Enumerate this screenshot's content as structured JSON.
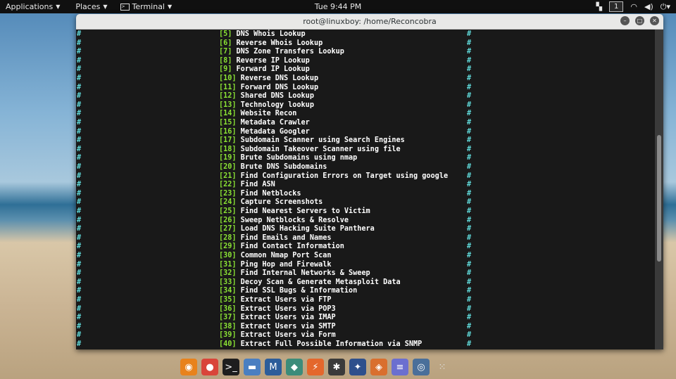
{
  "topbar": {
    "applications": "Applications",
    "places": "Places",
    "terminal": "Terminal",
    "clock": "Tue  9:44 PM",
    "workspace": "1"
  },
  "window": {
    "title": "root@linuxboy: /home/Reconcobra"
  },
  "terminal": {
    "border_char": "#",
    "lines": [
      {
        "num": "[5]",
        "label": "DNS Whois Lookup"
      },
      {
        "num": "[6]",
        "label": "Reverse Whois Lookup"
      },
      {
        "num": "[7]",
        "label": "DNS Zone Transfers Lookup"
      },
      {
        "num": "[8]",
        "label": "Reverse IP Lookup"
      },
      {
        "num": "[9]",
        "label": "Forward IP Lookup"
      },
      {
        "num": "[10]",
        "label": "Reverse DNS Lookup"
      },
      {
        "num": "[11]",
        "label": "Forward DNS Lookup"
      },
      {
        "num": "[12]",
        "label": "Shared DNS Lookup"
      },
      {
        "num": "[13]",
        "label": "Technology lookup"
      },
      {
        "num": "[14]",
        "label": "Website Recon"
      },
      {
        "num": "[15]",
        "label": "Metadata Crawler"
      },
      {
        "num": "[16]",
        "label": "Metadata Googler"
      },
      {
        "num": "[17]",
        "label": "Subdomain Scanner using Search Engines"
      },
      {
        "num": "[18]",
        "label": "Subdomain Takeover Scanner using file"
      },
      {
        "num": "[19]",
        "label": "Brute Subdomains using nmap"
      },
      {
        "num": "[20]",
        "label": "Brute DNS Subdomains"
      },
      {
        "num": "[21]",
        "label": "Find Configuration Errors on Target using google"
      },
      {
        "num": "[22]",
        "label": "Find ASN"
      },
      {
        "num": "[23]",
        "label": "Find Netblocks"
      },
      {
        "num": "[24]",
        "label": "Capture Screenshots"
      },
      {
        "num": "[25]",
        "label": "Find Nearest Servers to Victim"
      },
      {
        "num": "[26]",
        "label": "Sweep Netblocks & Resolve"
      },
      {
        "num": "[27]",
        "label": "Load DNS Hacking Suite Panthera"
      },
      {
        "num": "[28]",
        "label": "Find Emails and Names"
      },
      {
        "num": "[29]",
        "label": "Find Contact Information"
      },
      {
        "num": "[30]",
        "label": "Common Nmap Port Scan"
      },
      {
        "num": "[31]",
        "label": "Ping Hop and Firewalk"
      },
      {
        "num": "[32]",
        "label": "Find Internal Networks & Sweep"
      },
      {
        "num": "[33]",
        "label": "Decoy Scan & Generate Metasploit Data"
      },
      {
        "num": "[34]",
        "label": "Find SSL Bugs & Information"
      },
      {
        "num": "[35]",
        "label": "Extract Users via FTP"
      },
      {
        "num": "[36]",
        "label": "Extract Users via POP3"
      },
      {
        "num": "[37]",
        "label": "Extract Users via IMAP"
      },
      {
        "num": "[38]",
        "label": "Extract Users via SMTP"
      },
      {
        "num": "[39]",
        "label": "Extract Users via Form"
      },
      {
        "num": "[40]",
        "label": "Extract Full Possible Information via SNMP"
      }
    ]
  },
  "dock": {
    "items": [
      {
        "name": "firefox-icon",
        "glyph": "◉",
        "color": "#e8821c"
      },
      {
        "name": "chrome-icon",
        "glyph": "●",
        "color": "#d9453a"
      },
      {
        "name": "terminal-icon",
        "glyph": ">_",
        "color": "#1e1e1e"
      },
      {
        "name": "files-icon",
        "glyph": "▬",
        "color": "#4a7fc1"
      },
      {
        "name": "metasploit-icon",
        "glyph": "M",
        "color": "#2c5d9a"
      },
      {
        "name": "armitage-icon",
        "glyph": "◆",
        "color": "#3c8c7a"
      },
      {
        "name": "burpsuite-icon",
        "glyph": "⚡",
        "color": "#e4672c"
      },
      {
        "name": "maltego-icon",
        "glyph": "✱",
        "color": "#3a3a3a"
      },
      {
        "name": "beef-icon",
        "glyph": "✦",
        "color": "#2d4f8c"
      },
      {
        "name": "faraday-icon",
        "glyph": "◈",
        "color": "#d96f2e"
      },
      {
        "name": "notes-icon",
        "glyph": "≡",
        "color": "#6b6fd0"
      },
      {
        "name": "screenshot-icon",
        "glyph": "◎",
        "color": "#4a6f9a"
      },
      {
        "name": "app-grid-icon",
        "glyph": "⁙",
        "color": "transparent"
      }
    ]
  }
}
